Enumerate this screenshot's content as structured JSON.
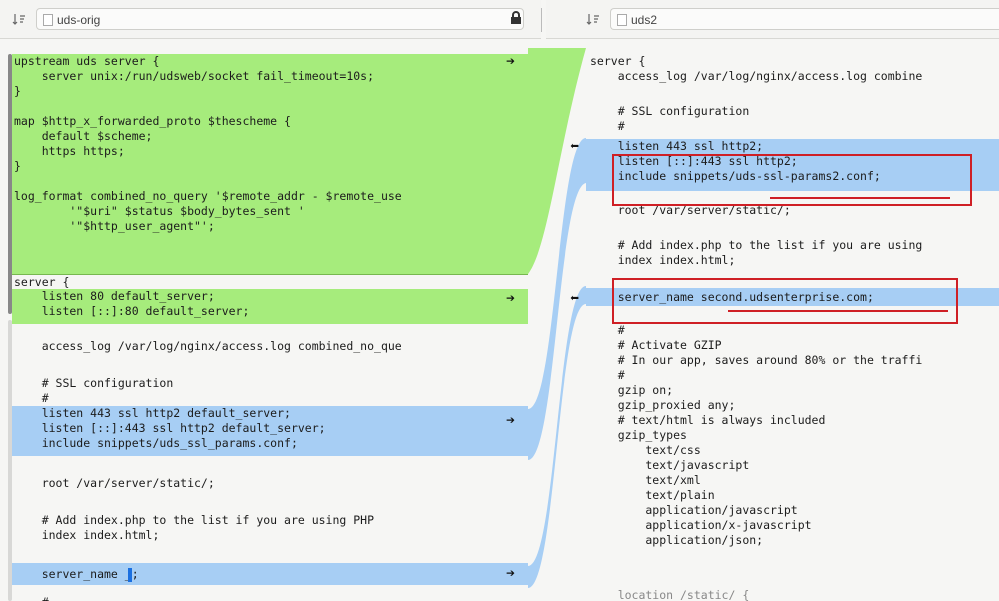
{
  "left_pane": {
    "filename": "uds-orig",
    "lines": [
      {
        "text": "upstream uds server {",
        "hl": "green"
      },
      {
        "text": "    server unix:/run/udsweb/socket fail_timeout=10s;",
        "hl": "green"
      },
      {
        "text": "}",
        "hl": "green"
      },
      {
        "text": "",
        "hl": "green"
      },
      {
        "text": "map $http_x_forwarded_proto $thescheme {",
        "hl": "green"
      },
      {
        "text": "    default $scheme;",
        "hl": "green"
      },
      {
        "text": "    https https;",
        "hl": "green"
      },
      {
        "text": "}",
        "hl": "green"
      },
      {
        "text": "",
        "hl": "green"
      },
      {
        "text": "log_format combined_no_query '$remote_addr - $remote_use",
        "hl": "green"
      },
      {
        "text": "        '\"$uri\" $status $body_bytes_sent '",
        "hl": "green"
      },
      {
        "text": "        '\"$http_user_agent\"';",
        "hl": "green"
      },
      {
        "text": "",
        "hl": "green"
      },
      {
        "text": "server {",
        "hl": ""
      },
      {
        "text": "    listen 80 default_server;",
        "hl": "green"
      },
      {
        "text": "    listen [::]:80 default_server;",
        "hl": "green"
      },
      {
        "text": "",
        "hl": ""
      },
      {
        "text": "    access_log /var/log/nginx/access.log combined_no_que",
        "hl": ""
      },
      {
        "text": "",
        "hl": ""
      },
      {
        "text": "    # SSL configuration",
        "hl": ""
      },
      {
        "text": "    #",
        "hl": ""
      },
      {
        "text": "    listen 443 ssl http2 default_server;",
        "hl": "blue"
      },
      {
        "text": "    listen [::]:443 ssl http2 default_server;",
        "hl": "blue"
      },
      {
        "text": "    include snippets/uds_ssl_params.conf;",
        "hl": "blue"
      },
      {
        "text": "",
        "hl": ""
      },
      {
        "text": "    root /var/server/static/;",
        "hl": ""
      },
      {
        "text": "",
        "hl": ""
      },
      {
        "text": "    # Add index.php to the list if you are using PHP",
        "hl": ""
      },
      {
        "text": "    index index.html;",
        "hl": ""
      },
      {
        "text": "",
        "hl": ""
      },
      {
        "text": "    server_name _;",
        "hl": "blue"
      },
      {
        "text": "",
        "hl": ""
      },
      {
        "text": "    #",
        "hl": ""
      }
    ]
  },
  "right_pane": {
    "filename": "uds2",
    "lines": [
      {
        "text": "server {",
        "hl": ""
      },
      {
        "text": "    access_log /var/log/nginx/access.log combine",
        "hl": ""
      },
      {
        "text": "",
        "hl": ""
      },
      {
        "text": "    # SSL configuration",
        "hl": ""
      },
      {
        "text": "    #",
        "hl": ""
      },
      {
        "text": "    listen 443 ssl http2;",
        "hl": "blue"
      },
      {
        "text": "    listen [::]:443 ssl http2;",
        "hl": "blue"
      },
      {
        "text": "    include snippets/uds-ssl-params2.conf;",
        "hl": "blue"
      },
      {
        "text": "",
        "hl": ""
      },
      {
        "text": "    root /var/server/static/;",
        "hl": ""
      },
      {
        "text": "",
        "hl": ""
      },
      {
        "text": "    # Add index.php to the list if you are using",
        "hl": ""
      },
      {
        "text": "    index index.html;",
        "hl": ""
      },
      {
        "text": "",
        "hl": ""
      },
      {
        "text": "    server_name second.udsenterprise.com;",
        "hl": "blue"
      },
      {
        "text": "",
        "hl": ""
      },
      {
        "text": "    #",
        "hl": ""
      },
      {
        "text": "    # Activate GZIP",
        "hl": ""
      },
      {
        "text": "    # In our app, saves around 80% or the traffi",
        "hl": ""
      },
      {
        "text": "    #",
        "hl": ""
      },
      {
        "text": "    gzip on;",
        "hl": ""
      },
      {
        "text": "    gzip_proxied any;",
        "hl": ""
      },
      {
        "text": "    # text/html is always included",
        "hl": ""
      },
      {
        "text": "    gzip_types",
        "hl": ""
      },
      {
        "text": "        text/css",
        "hl": ""
      },
      {
        "text": "        text/javascript",
        "hl": ""
      },
      {
        "text": "        text/xml",
        "hl": ""
      },
      {
        "text": "        text/plain",
        "hl": ""
      },
      {
        "text": "        application/javascript",
        "hl": ""
      },
      {
        "text": "        application/x-javascript",
        "hl": ""
      },
      {
        "text": "        application/json;",
        "hl": ""
      },
      {
        "text": "",
        "hl": ""
      },
      {
        "text": "    location /static/ {",
        "hl": ""
      }
    ]
  },
  "arrows": {
    "push_right": "➔",
    "push_left": "⬅"
  },
  "colors": {
    "added": "#a6ec7c",
    "changed": "#a7cef4",
    "inline_change": "#5a9ee8",
    "annotation": "#cf1f25"
  },
  "icons": {
    "pane_icon": "sort-order-icon",
    "lock": "lock-icon",
    "file": "file-icon"
  }
}
